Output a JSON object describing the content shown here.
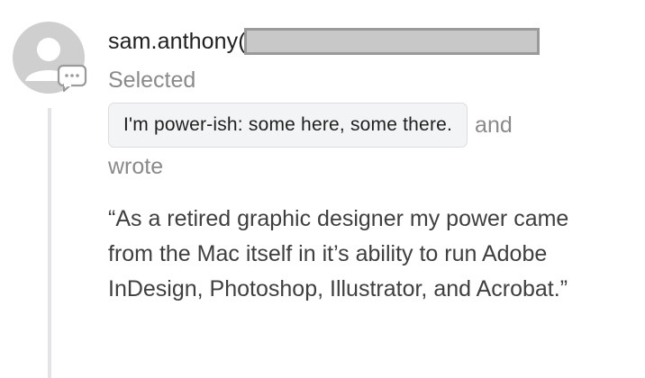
{
  "comment": {
    "username": "sam.anthony(",
    "selected_label": "Selected",
    "choice": "I'm power-ish: some here, some there.",
    "and_label": "and",
    "wrote_label": "wrote",
    "quote": "“As a retired graphic designer my power came from the Mac itself in it’s ability to run Adobe InDesign, Photoshop, Illustrator, and Acrobat.”"
  },
  "icons": {
    "avatar": "default-avatar-icon",
    "comment": "speech-bubble-icon"
  },
  "colors": {
    "avatar": "#cfcfcf",
    "thread_line": "#e4e4e6",
    "pill_bg": "#f3f4f6",
    "redaction": "#c8c8c8"
  }
}
